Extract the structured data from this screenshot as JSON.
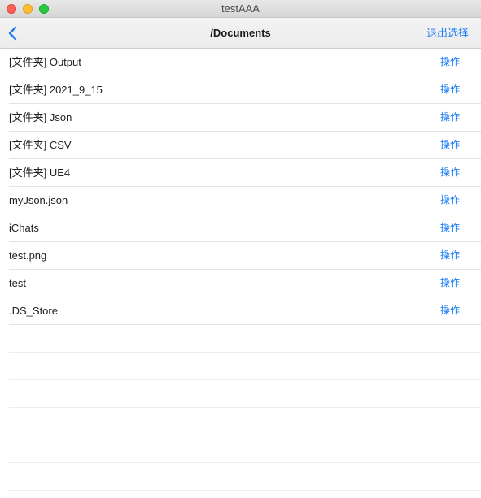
{
  "window": {
    "title": "testAAA"
  },
  "navbar": {
    "title": "/Documents",
    "right_label": "退出选择"
  },
  "files": [
    {
      "label": "[文件夹] Output",
      "action": "操作"
    },
    {
      "label": "[文件夹] 2021_9_15",
      "action": "操作"
    },
    {
      "label": "[文件夹] Json",
      "action": "操作"
    },
    {
      "label": "[文件夹] CSV",
      "action": "操作"
    },
    {
      "label": "[文件夹] UE4",
      "action": "操作"
    },
    {
      "label": "myJson.json",
      "action": "操作"
    },
    {
      "label": "iChats",
      "action": "操作"
    },
    {
      "label": "test.png",
      "action": "操作"
    },
    {
      "label": "test",
      "action": "操作"
    },
    {
      "label": ".DS_Store",
      "action": "操作"
    }
  ],
  "colors": {
    "accent": "#1a7cf5",
    "close": "#fe5f57",
    "minimize": "#febc2e",
    "maximize": "#28c840"
  }
}
